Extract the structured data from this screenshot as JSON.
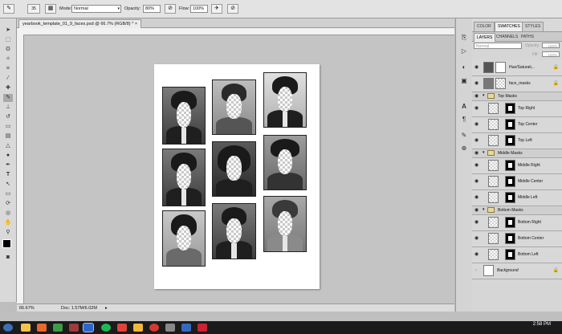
{
  "options_bar": {
    "brush_size": "35",
    "mode_label": "Mode:",
    "mode_value": "Normal",
    "opacity_label": "Opacity:",
    "opacity_value": "80%",
    "flow_label": "Flow:",
    "flow_value": "100%"
  },
  "document": {
    "tab_title": "yearbook_template_01_9_faces.psd @ 66.7% (RGB/8) *",
    "zoom": "66.67%",
    "doc_info": "Doc: 1.57M/6.02M"
  },
  "panels": {
    "top_tabs": [
      "COLOR",
      "SWATCHES",
      "STYLES"
    ],
    "layer_tabs": [
      "LAYERS",
      "CHANNELS",
      "PATHS"
    ],
    "blend_mode": "Normal",
    "opacity_label": "Opacity:",
    "opacity_value": "100%",
    "fill_label": "Fill:",
    "fill_value": "100%"
  },
  "layers": [
    {
      "name": "Hue/Saturati...",
      "kind": "adjustment"
    },
    {
      "name": "face_masks",
      "kind": "layer"
    },
    {
      "name": "Top Masks",
      "kind": "group"
    },
    {
      "name": "Top Right",
      "kind": "mask"
    },
    {
      "name": "Top Center",
      "kind": "mask"
    },
    {
      "name": "Top Left",
      "kind": "mask"
    },
    {
      "name": "Middle Masks",
      "kind": "group"
    },
    {
      "name": "Middle Right",
      "kind": "mask"
    },
    {
      "name": "Middle Center",
      "kind": "mask"
    },
    {
      "name": "Middle Left",
      "kind": "mask"
    },
    {
      "name": "Bottom Masks",
      "kind": "group"
    },
    {
      "name": "Bottom Right",
      "kind": "mask"
    },
    {
      "name": "Bottom Center",
      "kind": "mask"
    },
    {
      "name": "Bottom Left",
      "kind": "mask"
    },
    {
      "name": "Background",
      "kind": "background"
    }
  ],
  "taskbar": {
    "time": "2:58 PM"
  }
}
